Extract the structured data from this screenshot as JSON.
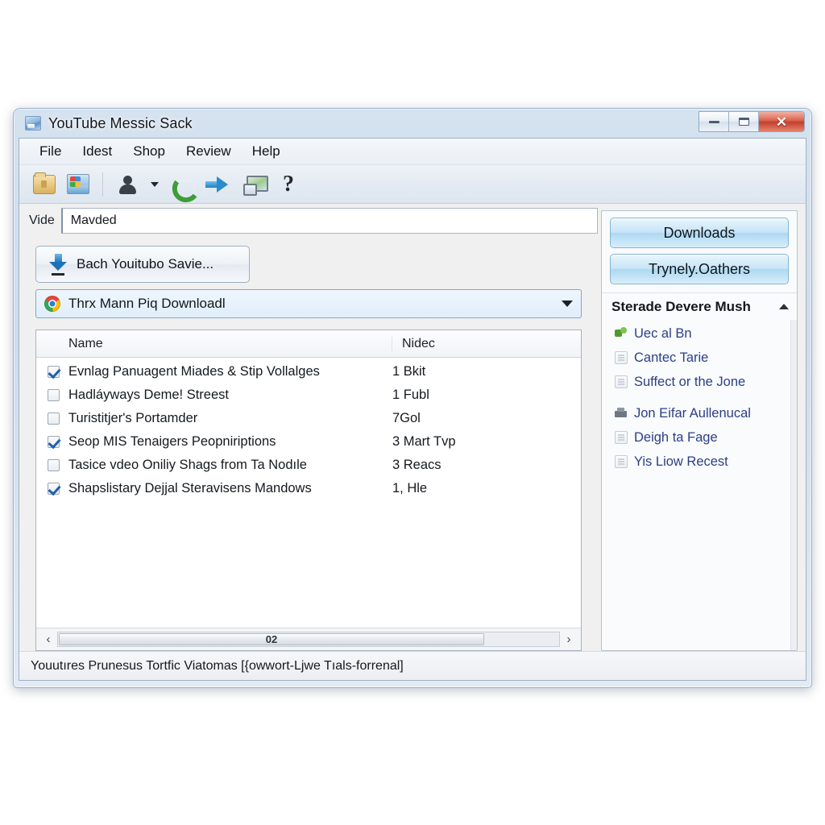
{
  "window": {
    "title": "YouTube Messic Sack",
    "title_icon": "picture-window-icon",
    "controls": {
      "minimize": "minimize-icon",
      "maximize": "maximize-icon",
      "close": "✕"
    }
  },
  "menubar": {
    "items": [
      {
        "label": "File"
      },
      {
        "label": "Idest"
      },
      {
        "label": "Shop"
      },
      {
        "label": "Review"
      },
      {
        "label": "Help"
      }
    ]
  },
  "toolbar": {
    "items": [
      {
        "icon": "folder-lock-icon"
      },
      {
        "icon": "windows-picture-icon"
      },
      {
        "icon": "user-account-icon"
      },
      {
        "icon": "dropdown-caret-icon"
      },
      {
        "icon": "phone-call-icon"
      },
      {
        "icon": "blue-right-arrow-icon"
      },
      {
        "icon": "monitor-screen-icon"
      },
      {
        "icon": "help-question-icon",
        "glyph": "?"
      }
    ]
  },
  "address": {
    "label": "Vide",
    "value": "Mavded",
    "placeholder": "Mavded"
  },
  "save_button": {
    "label": "Bach Youitubo Savie...",
    "icon": "download-arrow-icon"
  },
  "combo": {
    "icon": "chrome-browser-icon",
    "value": "Thrx Mann Piq Downloadl",
    "caret": "chevron-down-icon"
  },
  "list": {
    "columns": [
      {
        "label": "Name"
      },
      {
        "label": "Nidec"
      }
    ],
    "rows": [
      {
        "checked": true,
        "name": "Evnlag Panuagent Miades & Stip Vollalges",
        "size": "1 Bkit"
      },
      {
        "checked": false,
        "name": "Hadláyways Deme! Streest",
        "size": "1 Fubl"
      },
      {
        "checked": false,
        "name": "Turistitjer's Portamder",
        "size": "7Gol"
      },
      {
        "checked": true,
        "name": "Seop MIS Tenaigers Peopniriptions",
        "size": "3 Mart Tvp"
      },
      {
        "checked": false,
        "name": "Tasice vdeo Oniliy Shags from Ta Nodıle",
        "size": "3 Reacs"
      },
      {
        "checked": true,
        "name": "Shapslistary Dejjal Steravisens Mandows",
        "size": "1, Hle"
      }
    ]
  },
  "hscrollbar": {
    "left_arrow": "‹",
    "right_arrow": "›",
    "thumb_label": "02"
  },
  "sidebar": {
    "buttons": [
      {
        "label": "Downloads"
      },
      {
        "label": "Trynely.Oathers"
      }
    ],
    "section": {
      "title": "Sterade Devere Mush",
      "collapse_icon": "chevron-up-icon"
    },
    "links": [
      {
        "label": "Uec al Bn",
        "icon": "network-share-icon"
      },
      {
        "label": "Cantec Tarie",
        "icon": "document-icon"
      },
      {
        "label": "Suffect or the Jone",
        "icon": "document-icon"
      },
      {
        "label": "Jon Eifar Aullenucal",
        "icon": "printer-icon"
      },
      {
        "label": "Deigh ta Fage",
        "icon": "document-icon"
      },
      {
        "label": "Yis Liow Recest",
        "icon": "document-icon"
      }
    ]
  },
  "statusbar": {
    "text": "Youutıres Prunesus Tortfic Viatomas [{owwort-Ljwe Tıals-forrenal]"
  },
  "colors": {
    "accent_blue": "#2b8bcb",
    "link_blue": "#2b3f86",
    "close_red": "#c13f2a",
    "frame_blue": "#cfdced"
  }
}
